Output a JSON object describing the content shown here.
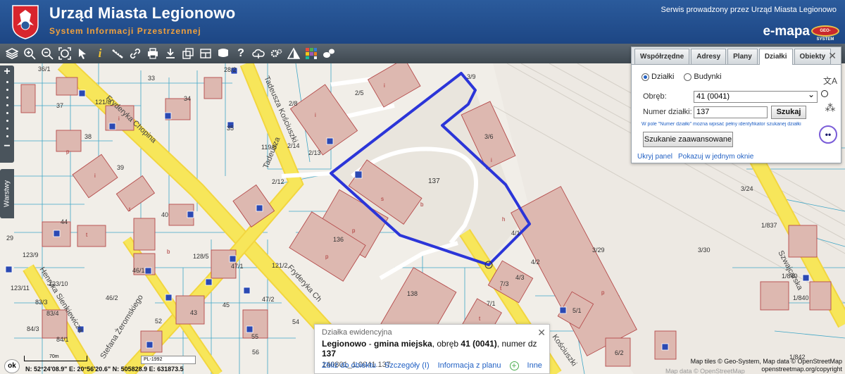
{
  "header": {
    "title": "Urząd Miasta Legionowo",
    "subtitle": "System Informacji Przestrzennej",
    "service": "Serwis prowadzony przez Urząd Miasta Legionowo",
    "brand": "e-mapa",
    "brand_logo_text": "GEO-SYSTEM"
  },
  "toolbar": {
    "icons": [
      "layers-icon",
      "zoom-in-icon",
      "zoom-out-icon",
      "zoom-extent-icon",
      "pointer-icon",
      "info-icon",
      "measure-icon",
      "link-icon",
      "print-icon",
      "download-icon",
      "map-overlay-icon",
      "layout-icon",
      "chat-icon",
      "help-icon",
      "cloud-icon",
      "settings-icon",
      "warning-icon",
      "color-grid-icon",
      "comments-icon"
    ]
  },
  "left_panel": {
    "zoom_in": "+",
    "zoom_out": "−",
    "layers_tab": "Warstwy"
  },
  "search_panel": {
    "tabs": [
      "Współrzędne",
      "Adresy",
      "Plany",
      "Działki",
      "Obiekty"
    ],
    "active_tab": "Działki",
    "radio": {
      "option1": "Działki",
      "option2": "Budynki",
      "selected": "Działki"
    },
    "obreb_label": "Obręb:",
    "obreb_value": "41 (0041)",
    "numer_label": "Numer działki:",
    "numer_value": "137",
    "search_button": "Szukaj",
    "hint": "W pole \"Numer działki\" można wpisać pełny identyfikator szukanej działki",
    "advanced_button": "Szukanie zaawansowane",
    "hide_link": "Ukryj panel",
    "one_window_link": "Pokazuj w jednym oknie"
  },
  "info_popup": {
    "heading": "Działka ewidencyjna",
    "place": "Legionowo",
    "sep1": " - ",
    "gmina": "gmina miejska",
    "mid": ", obręb ",
    "obreb": "41 (0041)",
    "mid2": ", numer dz ",
    "numer": "137",
    "identifier": "140801_1.0041.137",
    "links": [
      "Zbliż do obiektu",
      "Szczegóły (I)",
      "Informacja z planu",
      "Inne"
    ]
  },
  "status": {
    "ok": "ok",
    "scale": "70m",
    "crs": "PL-1992",
    "coordinates": "N: 52°24'08.9\"  E: 20°56'20.6\"  N: 505828.9  E: 631873.5",
    "attribution1": "Map tiles © Geo-System, Map data © OpenStreetMap",
    "attribution2": "openstreetmap.org/copyright",
    "attribution_faded": "Map data © OpenStreetMap"
  },
  "map_labels": {
    "streets": [
      "Fryderyka Chopina",
      "Tadeusza Kościuszki",
      "Henryka Sienkiewicza",
      "Stefana Żeromskiego",
      "Szwajcarska"
    ],
    "parcels": [
      "36/1",
      "33",
      "28/2",
      "3/9",
      "2/5",
      "34",
      "37",
      "2/8",
      "121/8",
      "35",
      "3/6",
      "38",
      "119/5",
      "2/14",
      "2/13",
      "39",
      "137",
      "2/12",
      "40",
      "3/24",
      "44",
      "1/837",
      "136",
      "4/1",
      "29",
      "3/30",
      "128/5",
      "4/2",
      "46/1",
      "47/1",
      "121/2",
      "1/840",
      "123/10",
      "123/9",
      "4/3",
      "123/11",
      "7/3",
      "46/2",
      "47/2",
      "138",
      "83/3",
      "45",
      "43",
      "7/1",
      "84/3",
      "52",
      "5/1",
      "55",
      "54",
      "83/4",
      "84/1",
      "1/842",
      "6/2",
      "56",
      "130/5",
      "1/840"
    ]
  },
  "colors": {
    "header": "#1d4684",
    "selected_parcel": "#2b35d8",
    "parcel_line": "#3fa6c6",
    "building_fill": "#ddb8b0",
    "building_line": "#b54b4b",
    "road": "#f7e65a",
    "brand_accent": "#f2a13c"
  }
}
